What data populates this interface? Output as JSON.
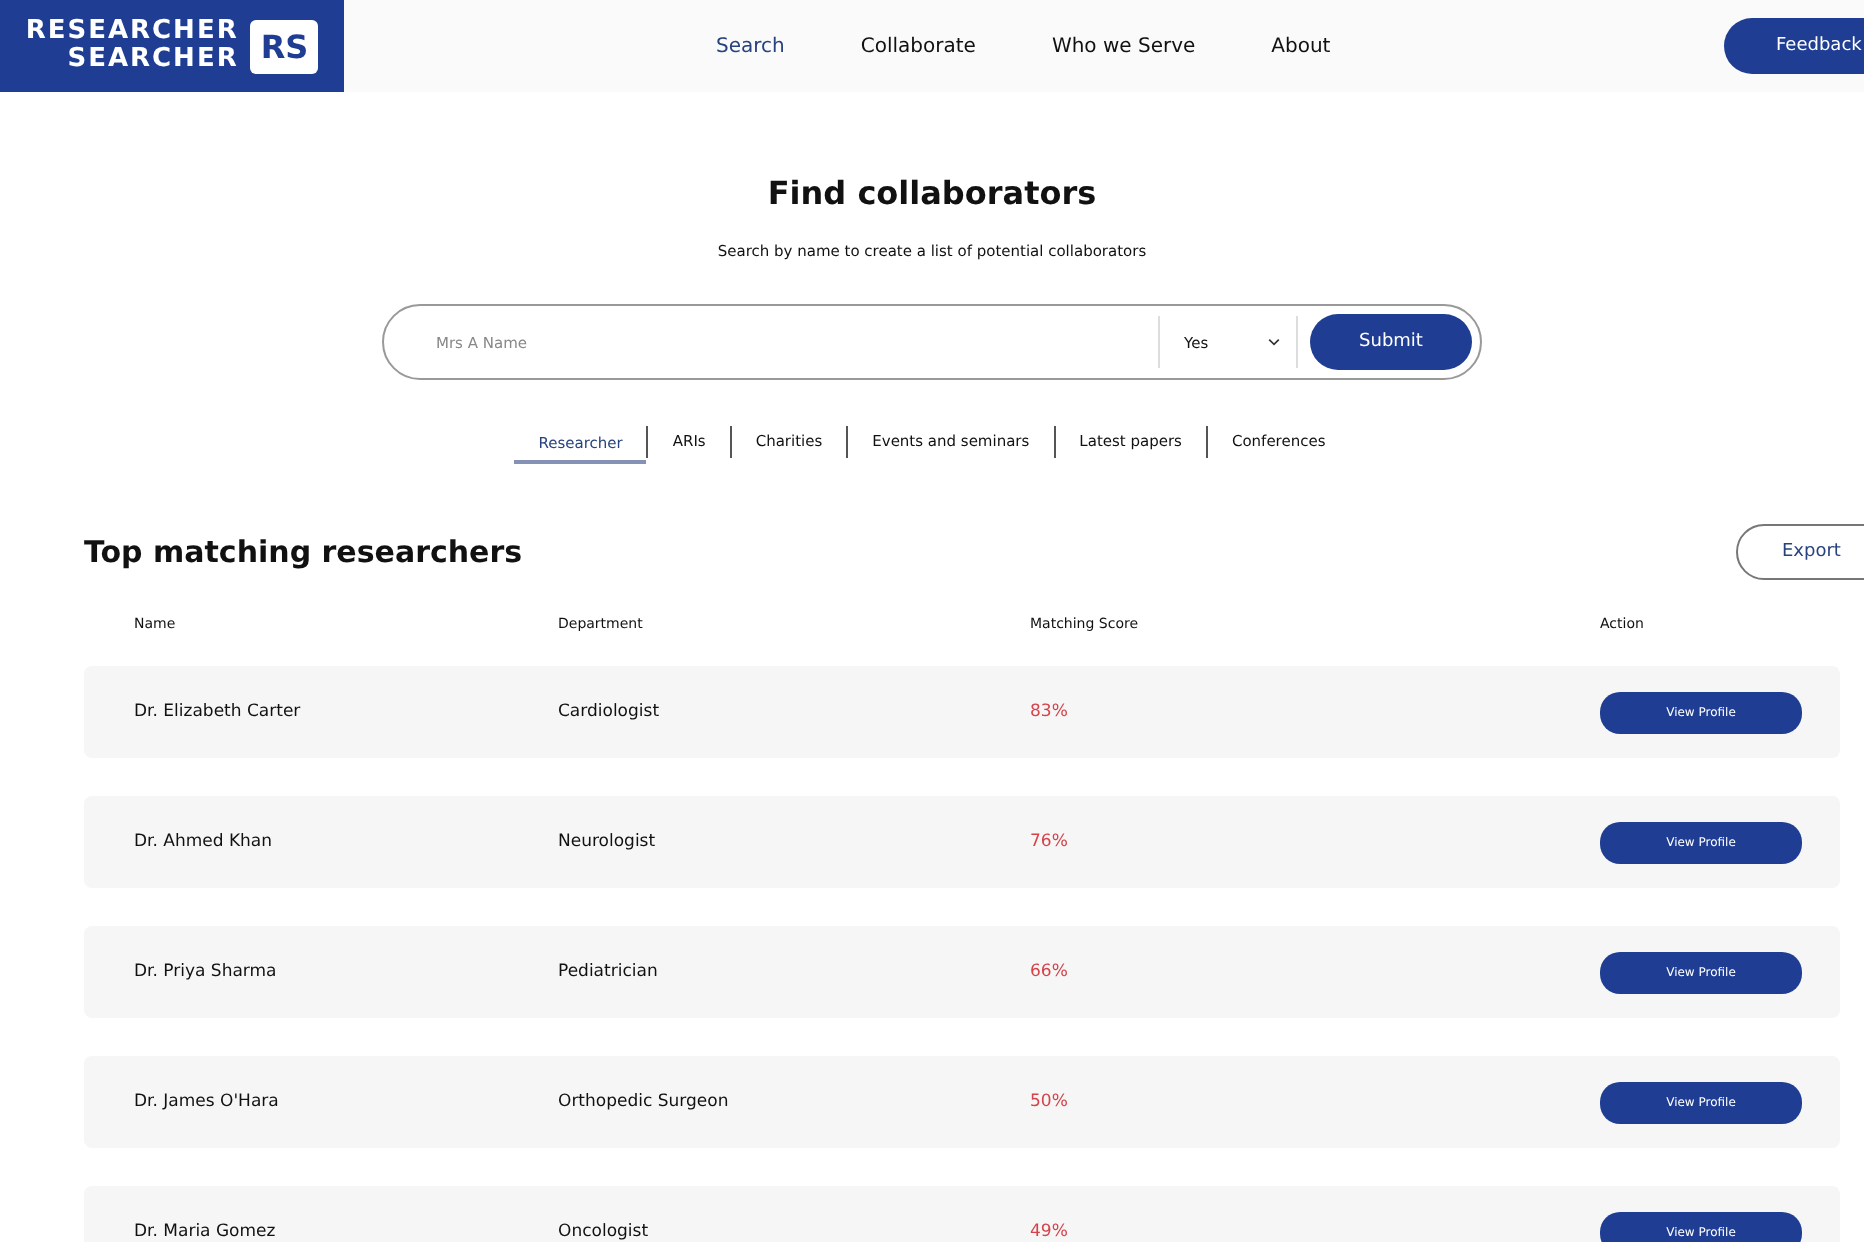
{
  "header": {
    "logo_text": [
      "RESEARCHER",
      "SEARCHER"
    ],
    "logo_badge": "RS",
    "nav": [
      {
        "label": "Search",
        "selected": true
      },
      {
        "label": "Collaborate",
        "selected": false
      },
      {
        "label": "Who we Serve",
        "selected": false
      },
      {
        "label": "About",
        "selected": false
      }
    ],
    "feedback_button": "Feedback"
  },
  "title": "Find collaborators",
  "subtitle": "Search by name to create a list of potential collaborators",
  "search": {
    "placeholder": "Mrs A Name",
    "dropdown_value": "Yes",
    "submit": "Submit"
  },
  "tabs": [
    {
      "label": "Researcher",
      "selected": true
    },
    {
      "label": "ARIs",
      "selected": false
    },
    {
      "label": "Charities",
      "selected": false
    },
    {
      "label": "Events and seminars",
      "selected": false
    },
    {
      "label": "Latest papers",
      "selected": false
    },
    {
      "label": "Conferences",
      "selected": false
    }
  ],
  "results": {
    "heading": "Top matching researchers",
    "export_button": "Export",
    "columns": [
      "Name",
      "Department",
      "Matching Score",
      "Action"
    ],
    "rows": [
      {
        "name": "Dr. Elizabeth Carter",
        "department": "Cardiologist",
        "score": "83%",
        "action": "View Profile"
      },
      {
        "name": "Dr. Ahmed Khan",
        "department": "Neurologist",
        "score": "76%",
        "action": "View Profile"
      },
      {
        "name": "Dr. Priya Sharma",
        "department": "Pediatrician",
        "score": "66%",
        "action": "View Profile"
      },
      {
        "name": "Dr. James O'Hara",
        "department": "Orthopedic Surgeon",
        "score": "50%",
        "action": "View Profile"
      },
      {
        "name": "Dr. Maria Gomez",
        "department": "Oncologist",
        "score": "49%",
        "action": "View Profile"
      }
    ]
  }
}
